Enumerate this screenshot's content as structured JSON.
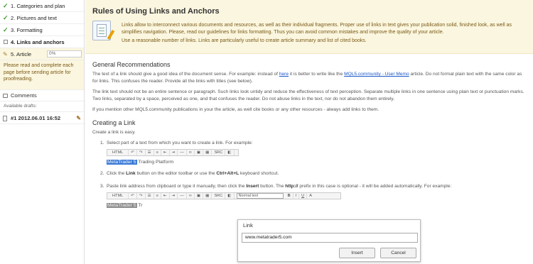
{
  "sidebar": {
    "steps": [
      {
        "label": "1. Categories and plan"
      },
      {
        "label": "2. Pictures and text"
      },
      {
        "label": "3. Formatting"
      },
      {
        "label": "4. Links and anchors"
      },
      {
        "label": "5. Article"
      }
    ],
    "article_progress": "0%",
    "notice": "Please read and complete each page before sending article for proofreading.",
    "comments_label": "Comments",
    "drafts_label": "Available drafts:",
    "draft_label": "#1 2012.06.01 16:52"
  },
  "banner": {
    "title": "Rules of Using Links and Anchors",
    "p1": "Links allow to interconnect various documents and resources, as well as their individual fragments. Proper use of links in text gives your publication solid, finished look, as well as simplifies navigation. Please, read our guidelines for links formatting. Thus you can avoid common mistakes and improve the quality of your article.",
    "p2": "Use a reasonable number of links. Links are particularly useful to create article summary and list of cited books."
  },
  "general": {
    "heading": "General Recommendations",
    "p1_a": "The text of a link should give a good idea of the document sense. For example: instead of ",
    "p1_link1": "here",
    "p1_b": " it is better to write like the ",
    "p1_link2": "MQL5.community - User Memo",
    "p1_c": " article. Do not format plain text with the same color as for links. This confuses the reader. Provide all the links with titles (see below).",
    "p2": "The link text should not be an entire sentence or paragraph. Such links look untidy and reduce the effectiveness of text perception. Separate multiple links in one sentence using plain text or punctuation marks. Two links, separated by a space, perceived as one, and that confuses the reader. Do not abuse links in the text, nor do not abandon them entirely.",
    "p3": "If you mention other MQL5.community publications in your the article, as well cite books or any other resources - always add links to them."
  },
  "creating": {
    "heading": "Creating a Link",
    "intro": "Create a link is easy.",
    "step1": "Select part of a text from which you want to create a link. For example:",
    "step2_a": "Click the ",
    "step2_b": "Link",
    "step2_c": " button on the editor toolbar or use the ",
    "step2_d": "Ctrl+Alt+L",
    "step2_e": " keyboard shortcut.",
    "step3_a": "Paste link address from clipboard or type it manually, then click the ",
    "step3_b": "Insert",
    "step3_c": " button. The ",
    "step3_d": "http://",
    "step3_e": " prefix in this case is optional - it will be added automatically. For example:",
    "sample_selected": "MetaTrader 5",
    "sample_rest": " Trading Platform",
    "sample_rest_short": " Tr"
  },
  "toolbar": {
    "html": "HTML",
    "undo": "↶",
    "redo": "↷",
    "src": "SRC",
    "format_select": "Normal text",
    "bold": "B",
    "italic": "I",
    "underline": "U",
    "color": "A"
  },
  "dialog": {
    "title": "Link",
    "url_value": "www.metatrader5.com",
    "insert_label": "Insert",
    "cancel_label": "Cancel"
  }
}
